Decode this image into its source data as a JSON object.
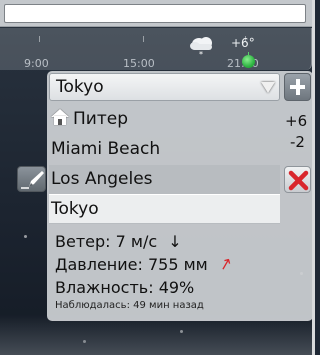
{
  "timeline": {
    "ticks": [
      {
        "label": "9:00"
      },
      {
        "label": "15:00"
      },
      {
        "label": "21:00"
      }
    ],
    "temperature": "+6°",
    "weather_icon": "snow-cloud-icon"
  },
  "city_selector": {
    "selected": "Tokyo",
    "add_icon": "plus-icon",
    "arrow_icon": "dropdown-arrow-icon"
  },
  "city_list": [
    {
      "label": "Питер",
      "home": true
    },
    {
      "label": "Miami Beach"
    },
    {
      "label": "Los Angeles"
    },
    {
      "label": "Tokyo"
    }
  ],
  "side_temps": [
    "+6",
    "-2"
  ],
  "details": {
    "wind": "Ветер:  7 м/с",
    "wind_arrow": "↓",
    "pressure": "Давление:  755 мм",
    "pressure_arrow": "↑",
    "humidity": "Влажность:  49%",
    "observed": "Наблюдалась:  49 мин назад"
  },
  "colors": {
    "accent_green": "#2fb543",
    "delete_red": "#d9262c",
    "pressure_arrow_red": "#d9262c"
  }
}
